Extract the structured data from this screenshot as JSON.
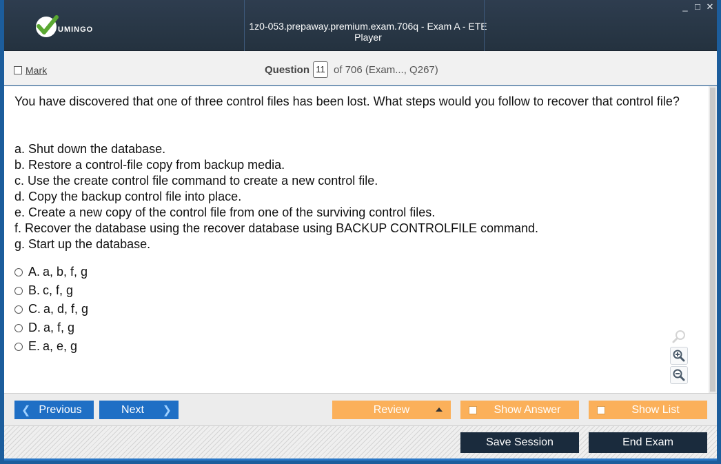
{
  "app": {
    "logo_text": "UMINGO",
    "window_title": "1z0-053.prepaway.premium.exam.706q - Exam A - ETE Player",
    "window_controls": [
      "_",
      "□",
      "✕"
    ]
  },
  "header": {
    "mark_label": "Mark",
    "question_label": "Question",
    "question_number": "11",
    "question_of": "of 706 (Exam..., Q267)"
  },
  "question": {
    "text": "You have discovered that one of three control files has been lost. What steps would you follow to recover that control file?",
    "steps": [
      "a. Shut down the database.",
      "b. Restore a control-file copy from backup media.",
      "c. Use the create control file command to create a new control file.",
      "d. Copy the backup control file into place.",
      "e. Create a new copy of the control file from one of the surviving control files.",
      "f. Recover the database using the recover database using BACKUP CONTROLFILE command.",
      "g. Start up the database."
    ],
    "answers": [
      {
        "letter": "A.",
        "text": "a, b, f, g"
      },
      {
        "letter": "B.",
        "text": "c, f, g"
      },
      {
        "letter": "C.",
        "text": "a, d, f, g"
      },
      {
        "letter": "D.",
        "text": "a, f, g"
      },
      {
        "letter": "E.",
        "text": "a, e, g"
      }
    ]
  },
  "zoom": {
    "icons": [
      "search-icon",
      "zoom-in-icon",
      "zoom-out-icon"
    ]
  },
  "nav": {
    "previous_label": "Previous",
    "next_label": "Next",
    "review_label": "Review",
    "show_answer_label": "Show Answer",
    "show_list_label": "Show List"
  },
  "footer": {
    "save_label": "Save Session",
    "end_label": "End Exam"
  },
  "colors": {
    "title_bar": "#2e3d4f",
    "nav_blue": "#1f6fc5",
    "orange": "#fbb05a",
    "dark_button": "#1a2b3d",
    "accent_green": "#5aa832"
  }
}
